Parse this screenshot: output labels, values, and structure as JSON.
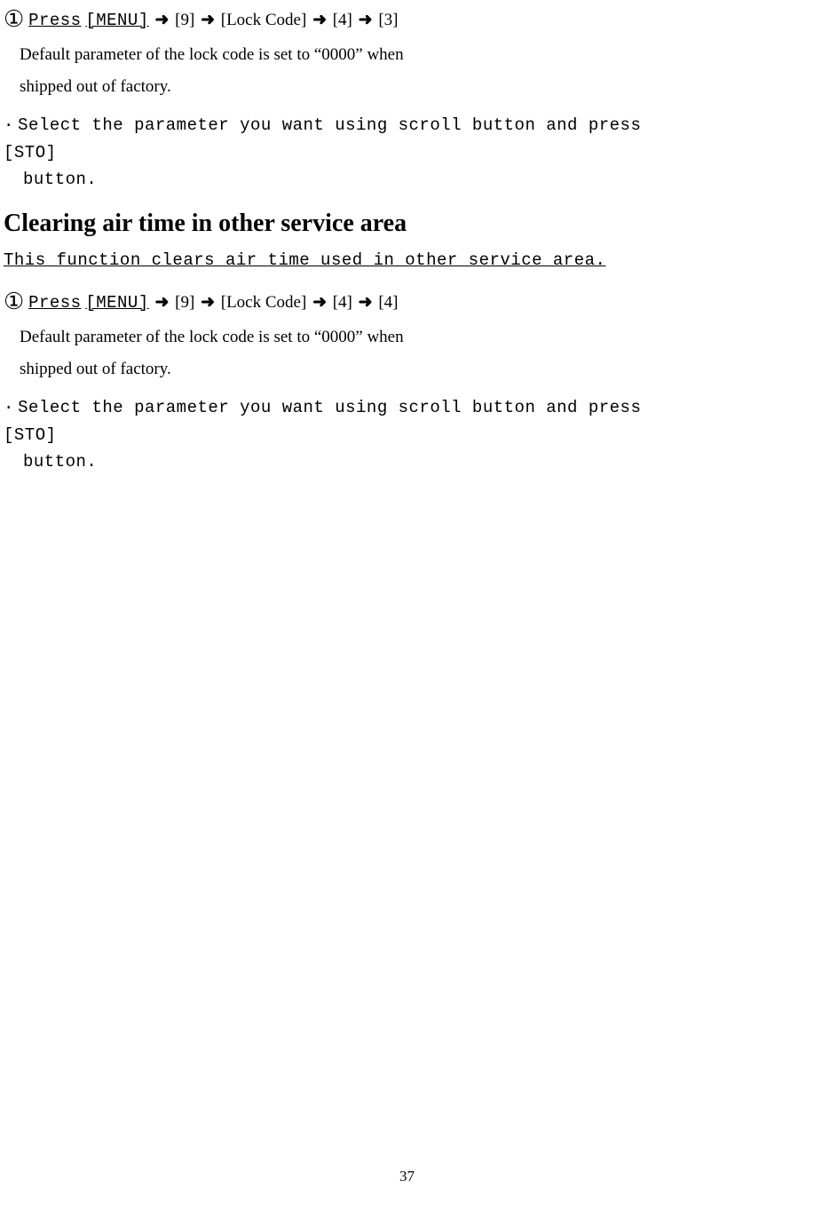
{
  "step1": {
    "circled": "①",
    "press_u": "Press",
    "menu_u": "[MENU]",
    "seq": {
      "nine": "[9]",
      "lock": "[Lock Code]",
      "four": "[4]",
      "three": "[3]"
    },
    "default_line1": "Default parameter of the lock code is set to “0000” when",
    "default_line2": "shipped out of factory."
  },
  "select1": {
    "dot": "·",
    "text": "Select the parameter you want using scroll button and press",
    "sto": "[STO]",
    "button": "button."
  },
  "heading": "Clearing air time in other service area",
  "intro": "This function clears air time used in other service area.",
  "step2": {
    "circled": "①",
    "press_u": "Press",
    "menu_u": "[MENU]",
    "seq": {
      "nine": "[9]",
      "lock": "[Lock Code]",
      "four_a": "[4]",
      "four_b": "[4]"
    },
    "default_line1": "Default parameter of the lock code is set to “0000” when",
    "default_line2": "shipped out of factory."
  },
  "select2": {
    "dot": "·",
    "text": "Select the parameter you want using scroll button and press",
    "sto": "[STO]",
    "button": "button."
  },
  "page_number": "37"
}
